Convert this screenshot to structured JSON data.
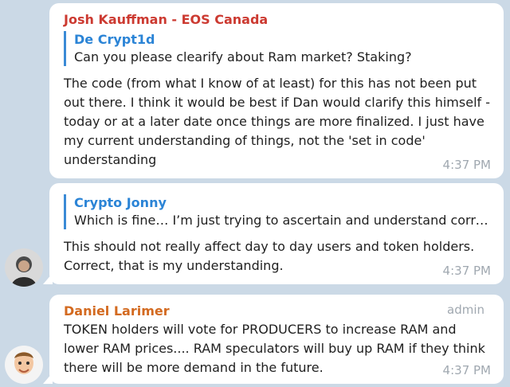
{
  "messages": [
    {
      "author": "Josh Kauffman - EOS Canada",
      "author_color": "#cc3a31",
      "reply": {
        "author": "De Crypt1d",
        "text": "Can you please clearify about Ram market? Staking?"
      },
      "text": "The code (from what I know of at least) for this has not been put out there. I think it would be best if Dan would clarify this himself - today or at a later date once things are more finalized. I just have my current understanding of things, not the 'set in code' understanding",
      "time": "4:37 PM"
    },
    {
      "reply": {
        "author": "Crypto Jonny",
        "text": "Which is fine…  I’m just trying to ascertain and understand corre…"
      },
      "text": "This should not really affect day to day users and token holders. Correct, that is my understanding.",
      "time": "4:37 PM"
    },
    {
      "author": "Daniel Larimer",
      "author_color": "#d36a20",
      "tag": "admin",
      "text": "TOKEN holders will vote for PRODUCERS to increase RAM and lower RAM prices.... RAM speculators will buy up RAM if they think there will be more demand in the future.",
      "time": "4:37 PM"
    }
  ]
}
